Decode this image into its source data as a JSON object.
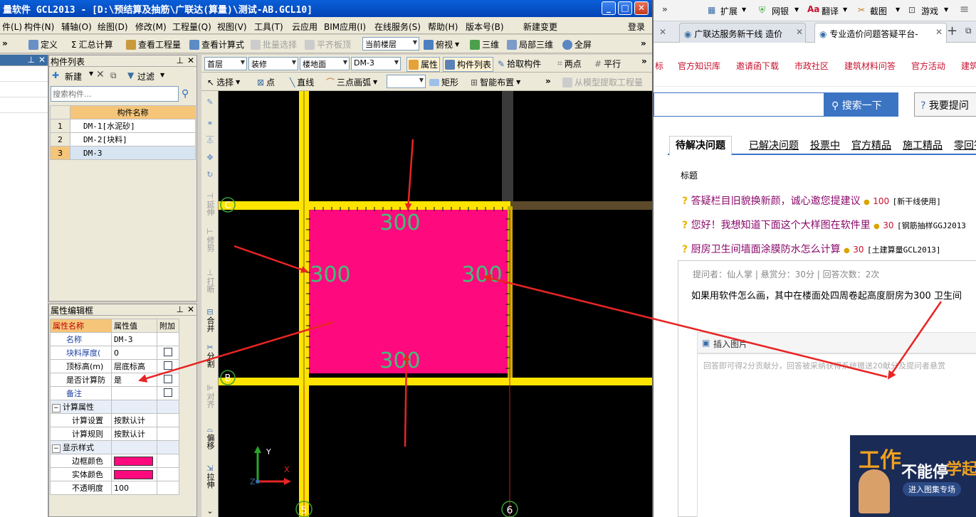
{
  "app": {
    "title": "量软件 GCL2013 - [D:\\预结算及抽筋\\广联达(算量)\\测试-AB.GCL10]",
    "menu": [
      "件(L)",
      "构件(N)",
      "辅轴(O)",
      "绘图(D)",
      "修改(M)",
      "工程量(Q)",
      "视图(V)",
      "工具(T)",
      "云应用",
      "BIM应用(I)",
      "在线服务(S)",
      "帮助(H)",
      "版本号(B)",
      "新建变更"
    ],
    "login": "登录",
    "toolbar": [
      "定义",
      "汇总计算",
      "查看工程量",
      "查看计算式",
      "批量选择",
      "平齐板顶",
      "当前楼层",
      "俯视",
      "三维",
      "局部三维",
      "全屏"
    ],
    "component_list": {
      "header": "构件列表",
      "new_label": "新建",
      "filter_label": "过滤",
      "search_placeholder": "搜索构件...",
      "column": "构件名称",
      "rows": [
        {
          "no": "1",
          "name": "DM-1[水泥砂]"
        },
        {
          "no": "2",
          "name": "DM-2[块料]"
        },
        {
          "no": "3",
          "name": "DM-3"
        }
      ]
    },
    "property_editor": {
      "header": "属性编辑框",
      "columns": [
        "属性名称",
        "属性值",
        "附加"
      ],
      "rows": [
        {
          "name": "名称",
          "value": "DM-3"
        },
        {
          "name": "块料厚度(",
          "value": "0"
        },
        {
          "name": "顶标高(m)",
          "value": "层底标高"
        },
        {
          "name": "是否计算防",
          "value": "是"
        },
        {
          "name": "备注",
          "value": ""
        },
        {
          "name": "计算属性",
          "value": ""
        },
        {
          "name": "计算设置",
          "value": "按默认计"
        },
        {
          "name": "计算规则",
          "value": "按默认计"
        },
        {
          "name": "显示样式",
          "value": ""
        },
        {
          "name": "边框颜色",
          "value": ""
        },
        {
          "name": "实体颜色",
          "value": ""
        },
        {
          "name": "不透明度",
          "value": "100"
        }
      ]
    },
    "drawbar": {
      "floor": "首层",
      "category": "装修",
      "type": "楼地面",
      "component": "DM-3",
      "attr_button": "属性",
      "list_button": "构件列表",
      "pick_button": "拾取构件",
      "two_points": "两点",
      "parallel": "平行",
      "select": "选择",
      "point": "点",
      "line": "直线",
      "arc": "三点画弧",
      "rect": "矩形",
      "smart": "智能布置",
      "extract": "从模型提取工程量"
    },
    "vertical_tools": [
      "延伸",
      "修剪",
      "打断",
      "合并",
      "分割",
      "对齐",
      "偏移",
      "拉伸"
    ],
    "canvas": {
      "axis_labels": [
        "C",
        "B",
        "5",
        "6"
      ],
      "dims": [
        "300",
        "300",
        "300",
        "300"
      ],
      "ucs": [
        "Y",
        "X",
        "Z"
      ]
    },
    "colors": {
      "slab": "#ff0a7e",
      "wall": "#ffe400",
      "accent": "#e60073"
    }
  },
  "browser": {
    "toolbar": [
      "扩展",
      "网银",
      "翻译",
      "截图",
      "游戏"
    ],
    "tabs": [
      "广联达服务新干线 造价",
      "专业造价问题答疑平台-"
    ],
    "nav": [
      "标",
      "官方知识库",
      "邀请函下载",
      "市政社区",
      "建筑材料问答",
      "官方活动",
      "建筑"
    ],
    "search_button": "搜索一下",
    "ask_button": "我要提问",
    "qtabs": [
      "待解决问题",
      "已解决问题",
      "投票中",
      "官方精品",
      "施工精品",
      "零回答"
    ],
    "list_header": "标题",
    "questions": [
      {
        "title": "答疑栏目旧貌换新颜，诚心邀您提建议",
        "points": "100",
        "tag": "[新干线使用]"
      },
      {
        "title": "您好！我想知道下面这个大样图在软件里",
        "points": "30",
        "tag": "[钢筋抽样GGJ2013"
      },
      {
        "title": "厨房卫生间墙面涂膜防水怎么计算",
        "points": "30",
        "tag": "[土建算量GCL2013]"
      }
    ],
    "meta": "提问者：仙人掌  |  悬赏分：30分  |  回答次数：2次",
    "question_text": "如果用软件怎么画，其中在楼面处四周卷起高度厨房为300 卫生间",
    "insert_image": "插入图片",
    "answer_hint": "回答即可得2分贡献分，回答被采纳获得系统赠送20献分及提问者悬赏",
    "ad": {
      "line1": "工作",
      "line2": "不能停",
      "line3": "学起来",
      "button": "进入图集专场"
    }
  }
}
